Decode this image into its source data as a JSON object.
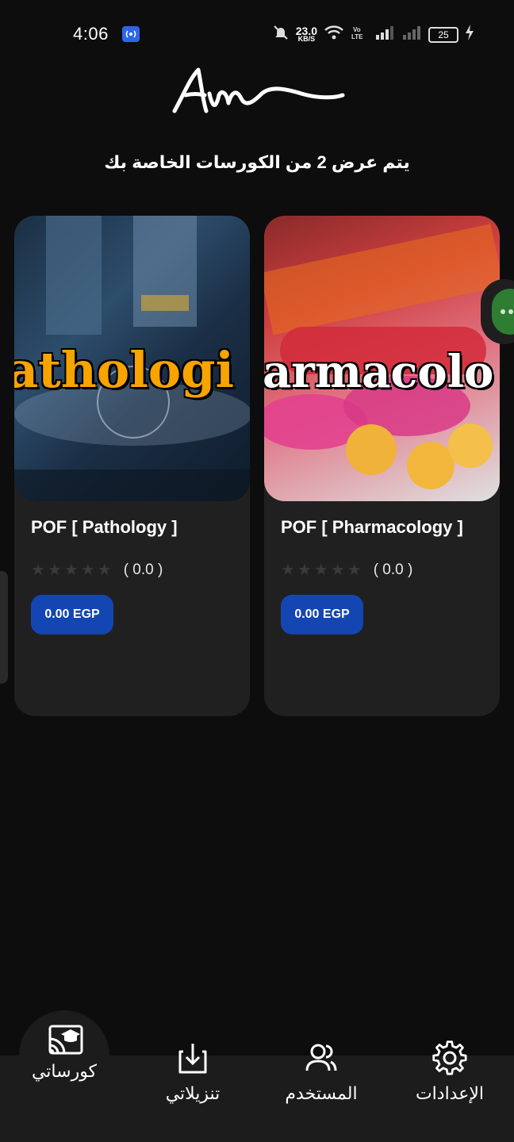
{
  "status_bar": {
    "time": "4:06",
    "data_speed": "23.0",
    "data_speed_unit": "KB/S",
    "battery": "25",
    "icons": [
      "hotspot-icon",
      "mute-icon",
      "wifi-icon",
      "volte-icon",
      "signal-icon",
      "signal-icon-2",
      "charging-icon"
    ]
  },
  "header": {
    "courses_count_text": "يتم عرض 2 من الكورسات الخاصة بك"
  },
  "courses": [
    {
      "image_text": "athologi",
      "title": "POF [ Pathology ]",
      "rating": "( 0.0 )",
      "stars_filled": 0,
      "price": "0.00 EGP"
    },
    {
      "image_text": "armacolo",
      "title": "POF [ Pharmacology ]",
      "rating": "( 0.0 )",
      "stars_filled": 0,
      "price": "0.00 EGP"
    }
  ],
  "bottom_nav": {
    "my_courses": "كورساتي",
    "downloads": "تنزيلاتي",
    "user": "المستخدم",
    "settings": "الإعدادات"
  },
  "colors": {
    "background": "#0d0d0d",
    "card": "#202020",
    "price_button": "#1446b3",
    "pathology_text": "#f7a300"
  }
}
